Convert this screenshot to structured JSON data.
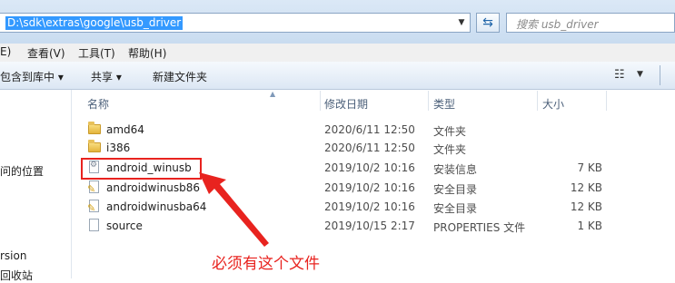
{
  "address": {
    "path": "D:\\sdk\\extras\\google\\usb_driver"
  },
  "search": {
    "placeholder": "搜索 usb_driver"
  },
  "menu": [
    "E)",
    "查看(V)",
    "工具(T)",
    "帮助(H)"
  ],
  "toolbar": {
    "include_library": "包含到库中 ▾",
    "share": "共享 ▾",
    "new_folder": "新建文件夹"
  },
  "left_pane": {
    "recent_places": "问的位置",
    "item_version": "rsion",
    "item_recycle": "回收站"
  },
  "columns": {
    "name": "名称",
    "date": "修改日期",
    "type": "类型",
    "size": "大小"
  },
  "files": [
    {
      "name": "amd64",
      "date": "2020/6/11 12:50",
      "type": "文件夹",
      "size": "",
      "icon": "folder-icon"
    },
    {
      "name": "i386",
      "date": "2020/6/11 12:50",
      "type": "文件夹",
      "size": "",
      "icon": "folder-icon"
    },
    {
      "name": "android_winusb",
      "date": "2019/10/2 10:16",
      "type": "安装信息",
      "size": "7 KB",
      "icon": "setup-info-icon"
    },
    {
      "name": "androidwinusb86",
      "date": "2019/10/2 10:16",
      "type": "安全目录",
      "size": "12 KB",
      "icon": "security-catalog-icon"
    },
    {
      "name": "androidwinusba64",
      "date": "2019/10/2 10:16",
      "type": "安全目录",
      "size": "12 KB",
      "icon": "security-catalog-icon"
    },
    {
      "name": "source",
      "date": "2019/10/15 2:17",
      "type": "PROPERTIES 文件",
      "size": "1 KB",
      "icon": "file-icon"
    }
  ],
  "annotation": {
    "text": "必须有这个文件",
    "color": "#e8231f"
  }
}
